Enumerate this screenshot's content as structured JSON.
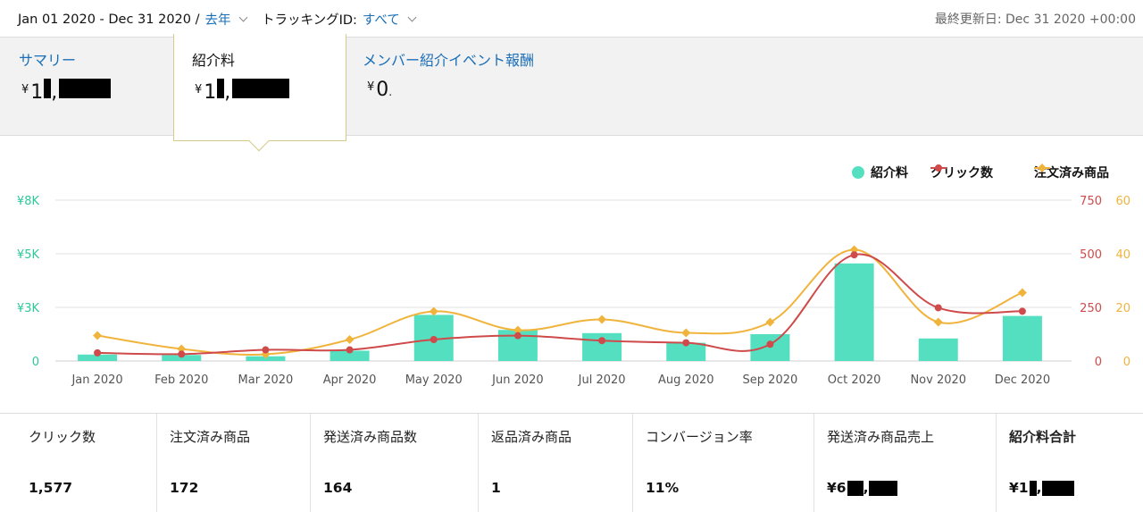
{
  "header": {
    "date_range": "Jan 01 2020 - Dec 31 2020 /",
    "date_preset": "去年",
    "tracking_label": "トラッキングID:",
    "tracking_value": "すべて",
    "last_updated": "最終更新日: Dec 31 2020 +00:00"
  },
  "tabs": [
    {
      "label": "サマリー",
      "value_prefix": "¥",
      "value_visible": "1",
      "value_suffix": ","
    },
    {
      "label": "紹介料",
      "value_prefix": "¥",
      "value_visible": "1",
      "value_suffix": ","
    },
    {
      "label": "メンバー紹介イベント報酬",
      "value_prefix": "¥",
      "value_visible": "0",
      "value_suffix": "."
    }
  ],
  "legend": {
    "fees": "紹介料",
    "clicks": "クリック数",
    "ordered": "注文済み商品"
  },
  "colors": {
    "fees": "#54e0c0",
    "clicks": "#cf4a4a",
    "ordered": "#f0b43c",
    "link": "#1a6fb8"
  },
  "chart_data": {
    "type": "bar",
    "categories": [
      "Jan 2020",
      "Feb 2020",
      "Mar 2020",
      "Apr 2020",
      "May 2020",
      "Jun 2020",
      "Jul 2020",
      "Aug 2020",
      "Sep 2020",
      "Oct 2020",
      "Nov 2020",
      "Dec 2020"
    ],
    "series": [
      {
        "name": "紹介料",
        "type": "bar",
        "axis": "left",
        "values": [
          300,
          280,
          220,
          480,
          2150,
          1450,
          1300,
          850,
          1250,
          4550,
          1050,
          2100
        ]
      },
      {
        "name": "クリック数",
        "type": "line",
        "axis": "right1",
        "values": [
          38,
          32,
          52,
          52,
          100,
          118,
          95,
          85,
          78,
          495,
          248,
          232
        ]
      },
      {
        "name": "注文済み商品",
        "type": "line",
        "axis": "right2",
        "values": [
          9.5,
          4.5,
          2.5,
          8,
          18.5,
          11.5,
          15.5,
          10.5,
          14.5,
          41.5,
          14.5,
          25.5
        ]
      }
    ],
    "y_left": {
      "ticks": [
        "0",
        "¥3K",
        "¥5K",
        "¥8K"
      ],
      "ylim": [
        0,
        7500
      ]
    },
    "y_right1": {
      "ticks": [
        "0",
        "250",
        "500",
        "750"
      ],
      "ylim": [
        0,
        750
      ]
    },
    "y_right2": {
      "ticks": [
        "0",
        "20",
        "40",
        "60"
      ],
      "ylim": [
        0,
        60
      ]
    },
    "legend_position": "top-right",
    "grid": true
  },
  "stats": [
    {
      "label": "クリック数",
      "value": "1,577"
    },
    {
      "label": "注文済み商品",
      "value": "172"
    },
    {
      "label": "発送済み商品数",
      "value": "164"
    },
    {
      "label": "返品済み商品",
      "value": "1"
    },
    {
      "label": "コンバージョン率",
      "value": "11%"
    },
    {
      "label": "発送済み商品売上",
      "value": "¥6",
      "value_suffix": ","
    },
    {
      "label": "紹介料合計",
      "value": "¥1",
      "value_suffix": ","
    }
  ]
}
